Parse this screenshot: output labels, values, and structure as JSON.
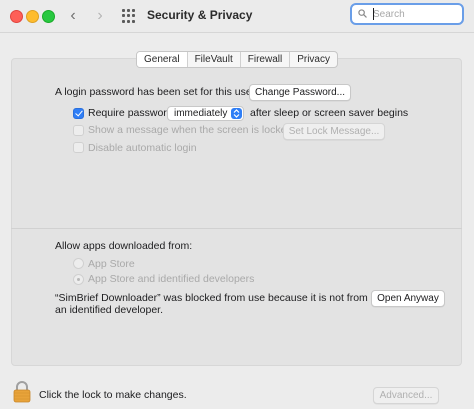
{
  "window": {
    "title": "Security & Privacy",
    "search_placeholder": "Search"
  },
  "tabs": [
    {
      "label": "General",
      "active": true
    },
    {
      "label": "FileVault",
      "active": false
    },
    {
      "label": "Firewall",
      "active": false
    },
    {
      "label": "Privacy",
      "active": false
    }
  ],
  "general": {
    "login_password_text": "A login password has been set for this user",
    "change_password_label": "Change Password...",
    "require_password_label": "Require password",
    "require_password_checked": true,
    "require_password_value": "immediately",
    "require_password_suffix": "after sleep or screen saver begins",
    "show_message_label": "Show a message when the screen is locked",
    "show_message_checked": false,
    "set_lock_message_label": "Set Lock Message...",
    "disable_auto_login_label": "Disable automatic login",
    "disable_auto_login_checked": false
  },
  "downloads": {
    "heading": "Allow apps downloaded from:",
    "options": [
      {
        "label": "App Store",
        "selected": false
      },
      {
        "label": "App Store and identified developers",
        "selected": true
      }
    ],
    "blocked_line1": "“SimBrief Downloader” was blocked from use because it is not from",
    "blocked_line2": "an identified developer.",
    "open_anyway_label": "Open Anyway"
  },
  "footer": {
    "lock_text": "Click the lock to make changes.",
    "advanced_label": "Advanced..."
  },
  "colors": {
    "accent": "#2f7ef6",
    "search_focus": "#6a9ee8",
    "lock": "#e8a33a"
  },
  "icons": [
    "back-chevron-icon",
    "forward-chevron-icon",
    "grid-icon",
    "search-icon",
    "lock-icon",
    "popup-arrows-icon"
  ]
}
